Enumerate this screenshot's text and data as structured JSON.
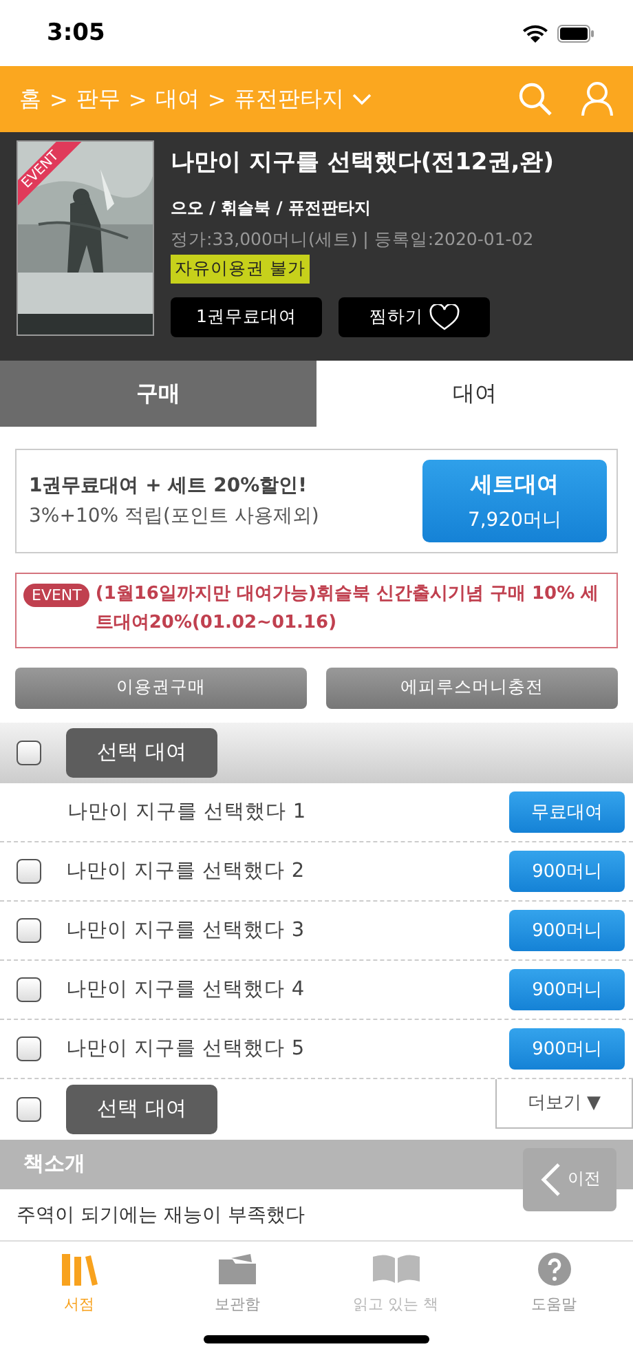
{
  "status_bar": {
    "time": "3:05"
  },
  "nav": {
    "breadcrumb": [
      "홈",
      ">",
      "판무",
      ">",
      "대여",
      ">",
      "퓨전판타지"
    ]
  },
  "book": {
    "badge": "EVENT",
    "title": "나만이 지구를 선택했다(전12권,완)",
    "meta": "으오 / 휘슬북 / 퓨전판타지",
    "price_info": "정가:33,000머니(세트) | 등록일:2020-01-02",
    "tag": "자유이용권 불가",
    "buttons": [
      "1권무료대여",
      "찜하기"
    ]
  },
  "tabs": [
    {
      "label": "구매",
      "selected": false
    },
    {
      "label": "대여",
      "selected": true
    }
  ],
  "promo": {
    "headline": "1권무료대여 + 세트 20%할인!",
    "subline": "3%+10% 적립(포인트 사용제외)",
    "button_label": "세트대여",
    "button_price": "7,920머니"
  },
  "event": {
    "badge": "EVENT",
    "text": "(1월16일까지만 대여가능)휘슬북 신간출시기념 구매 10% 세트대여20%(01.02~01.16)"
  },
  "actions": [
    "이용권구매",
    "에피루스머니충전"
  ],
  "select_top": {
    "label": "선택 대여",
    "checked": false
  },
  "episodes": [
    {
      "kind": "free",
      "title": "나만이 지구를 선택했다 1",
      "button": "무료대여"
    },
    {
      "kind": "paid",
      "title": "나만이 지구를 선택했다 2",
      "button": "900머니",
      "checked": false
    },
    {
      "kind": "paid",
      "title": "나만이 지구를 선택했다 3",
      "button": "900머니",
      "checked": false
    },
    {
      "kind": "paid",
      "title": "나만이 지구를 선택했다 4",
      "button": "900머니",
      "checked": false
    },
    {
      "kind": "paid",
      "title": "나만이 지구를 선택했다 5",
      "button": "900머니",
      "checked": false
    }
  ],
  "select_bottom": {
    "label": "선택 대여",
    "checked": false
  },
  "more": "더보기 ▼",
  "intro": {
    "heading": "책소개",
    "text": "주역이 되기에는 재능이 부족했다"
  },
  "prev_button": "이전",
  "tab_bar": [
    {
      "label": "서점",
      "selected": true,
      "disabled": false
    },
    {
      "label": "보관함",
      "selected": false,
      "disabled": false
    },
    {
      "label": "읽고 있는 책",
      "selected": false,
      "disabled": true
    },
    {
      "label": "도움말",
      "selected": false,
      "disabled": false
    }
  ]
}
